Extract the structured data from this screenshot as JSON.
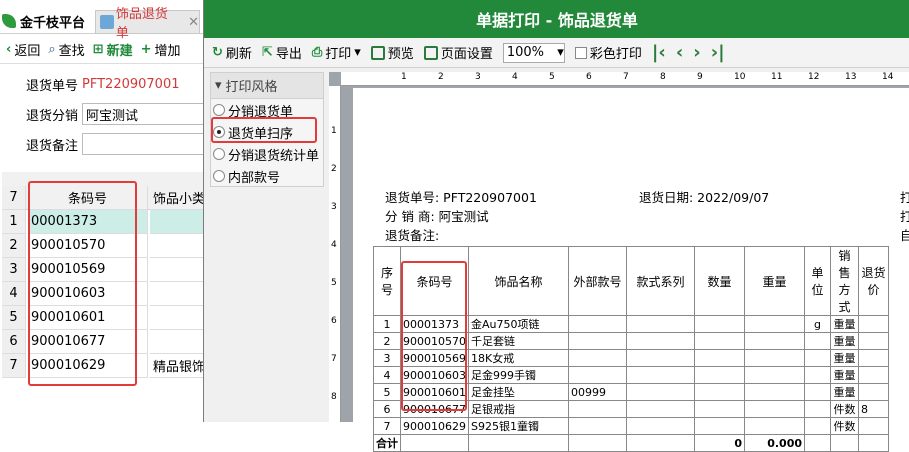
{
  "main_window": {
    "app_tab": "金千枝平台",
    "doc_tab": "饰品退货单",
    "toolbar": {
      "back": "返回",
      "find": "查找",
      "new": "新建",
      "add": "增加"
    },
    "form": {
      "return_no_label": "退货单号",
      "return_no_value": "PFT220907001",
      "distributor_label": "退货分销",
      "distributor_value": "阿宝测试",
      "remark_label": "退货备注",
      "remark_value": ""
    },
    "grid": {
      "header_rowno": "7",
      "header_code": "条码号",
      "header_extra": "饰品小类",
      "rows": [
        {
          "no": "1",
          "code": "00001373",
          "extra": ""
        },
        {
          "no": "2",
          "code": "900010570",
          "extra": ""
        },
        {
          "no": "3",
          "code": "900010569",
          "extra": ""
        },
        {
          "no": "4",
          "code": "900010603",
          "extra": ""
        },
        {
          "no": "5",
          "code": "900010601",
          "extra": ""
        },
        {
          "no": "6",
          "code": "900010677",
          "extra": ""
        },
        {
          "no": "7",
          "code": "900010629",
          "extra": "精品银饰"
        }
      ]
    }
  },
  "dialog": {
    "title": "单据打印 - 饰品退货单",
    "toolbar": {
      "refresh": "刷新",
      "export": "导出",
      "print": "打印",
      "preview": "预览",
      "page_setup": "页面设置",
      "zoom": "100%",
      "color_print": "彩色打印"
    },
    "style_panel": {
      "header": "打印风格",
      "options": [
        "分销退货单",
        "退货单扫序",
        "分销退货统计单",
        "内部款号"
      ],
      "selected": 1
    },
    "ruler_h": [
      "1",
      "2",
      "3",
      "4",
      "5",
      "6",
      "7",
      "8",
      "9",
      "10",
      "11",
      "12",
      "13",
      "14"
    ],
    "ruler_v": [
      "1",
      "2",
      "3",
      "4",
      "5",
      "6",
      "7",
      "8"
    ],
    "page": {
      "return_no": "退货单号: PFT220907001",
      "return_date": "退货日期: 2022/09/07",
      "distributor": "分 销 商: 阿宝测试",
      "remark": "退货备注:",
      "right_cut1": "打",
      "right_cut2": "打",
      "right_cut3": "自",
      "headers": [
        "序号",
        "条码号",
        "饰品名称",
        "外部款号",
        "款式系列",
        "数量",
        "重量",
        "单位",
        "销售方式",
        "退货价"
      ],
      "rows": [
        {
          "no": "1",
          "code": "00001373",
          "name": "金Au750项链",
          "ext": "",
          "series": "",
          "qty": "",
          "weight": "",
          "unit": "g",
          "mode": "重量",
          "price": ""
        },
        {
          "no": "2",
          "code": "900010570",
          "name": "千足套链",
          "ext": "",
          "series": "",
          "qty": "",
          "weight": "",
          "unit": "",
          "mode": "重量",
          "price": ""
        },
        {
          "no": "3",
          "code": "900010569",
          "name": "18K女戒",
          "ext": "",
          "series": "",
          "qty": "",
          "weight": "",
          "unit": "",
          "mode": "重量",
          "price": ""
        },
        {
          "no": "4",
          "code": "900010603",
          "name": "足金999手镯",
          "ext": "",
          "series": "",
          "qty": "",
          "weight": "",
          "unit": "",
          "mode": "重量",
          "price": ""
        },
        {
          "no": "5",
          "code": "900010601",
          "name": "足金挂坠",
          "ext": "00999",
          "series": "",
          "qty": "",
          "weight": "",
          "unit": "",
          "mode": "重量",
          "price": ""
        },
        {
          "no": "6",
          "code": "900010677",
          "name": "足银戒指",
          "ext": "",
          "series": "",
          "qty": "",
          "weight": "",
          "unit": "",
          "mode": "件数",
          "price": "8"
        },
        {
          "no": "7",
          "code": "900010629",
          "name": "S925银1童镯",
          "ext": "",
          "series": "",
          "qty": "",
          "weight": "",
          "unit": "",
          "mode": "件数",
          "price": ""
        }
      ],
      "total_label": "合计",
      "total_qty": "0",
      "total_weight": "0.000"
    }
  },
  "colors": {
    "title_bar": "#22893a",
    "highlight_box": "#e23b3b",
    "selected_row": "#cceee6"
  }
}
